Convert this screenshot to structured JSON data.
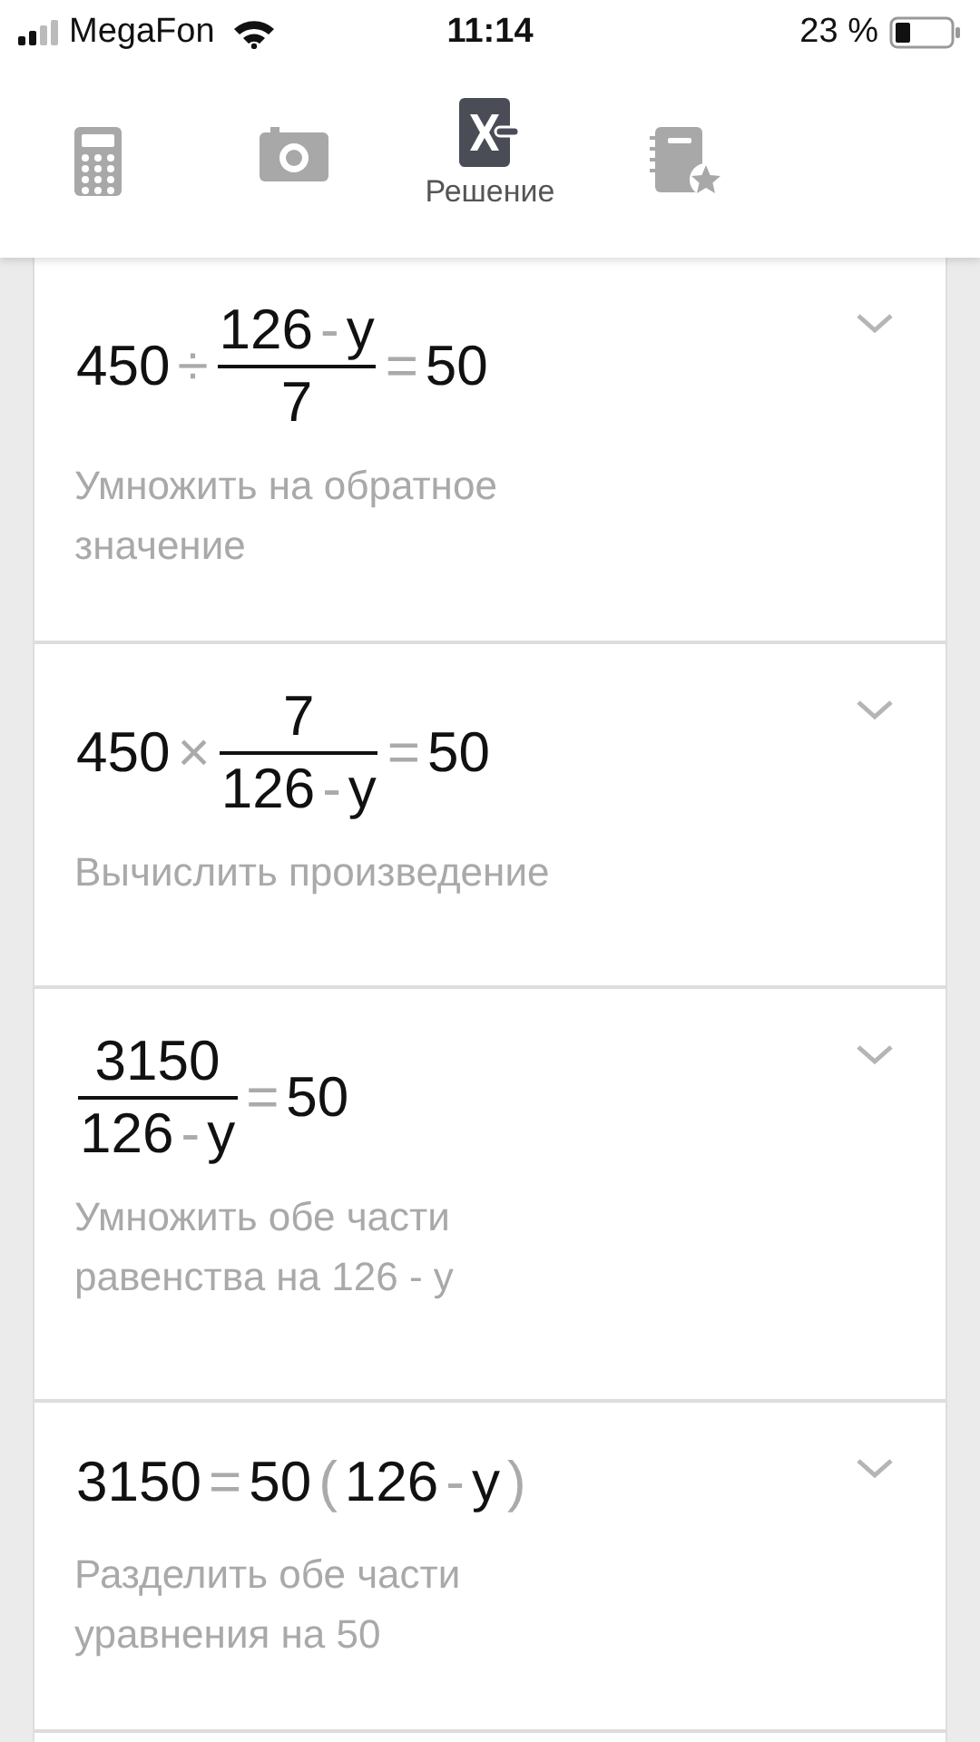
{
  "status_bar": {
    "carrier": "MegaFon",
    "time": "11:14",
    "battery": "23 %"
  },
  "tabs": [
    {
      "kind": "calculator",
      "selected": false
    },
    {
      "kind": "camera",
      "selected": false
    },
    {
      "kind": "solver",
      "label": "Решение",
      "selected": true
    },
    {
      "kind": "notebook",
      "selected": false
    }
  ],
  "steps": [
    {
      "expression": [
        {
          "kind": "num",
          "text": "450"
        },
        {
          "kind": "op",
          "text": "÷"
        },
        {
          "kind": "frac",
          "num": [
            {
              "kind": "num",
              "text": "126"
            },
            {
              "kind": "op",
              "text": "-"
            },
            {
              "kind": "num",
              "text": "y"
            }
          ],
          "den": [
            {
              "kind": "num",
              "text": "7"
            }
          ]
        },
        {
          "kind": "op",
          "text": "="
        },
        {
          "kind": "num",
          "text": "50"
        }
      ],
      "description": "Умножить на обратное значение"
    },
    {
      "expression": [
        {
          "kind": "num",
          "text": "450"
        },
        {
          "kind": "op",
          "text": "×"
        },
        {
          "kind": "frac",
          "num": [
            {
              "kind": "num",
              "text": "7"
            }
          ],
          "den": [
            {
              "kind": "num",
              "text": "126"
            },
            {
              "kind": "op",
              "text": "-"
            },
            {
              "kind": "num",
              "text": "y"
            }
          ]
        },
        {
          "kind": "op",
          "text": "="
        },
        {
          "kind": "num",
          "text": "50"
        }
      ],
      "description": "Вычислить произведение"
    },
    {
      "expression": [
        {
          "kind": "frac",
          "num": [
            {
              "kind": "num",
              "text": "3150"
            }
          ],
          "den": [
            {
              "kind": "num",
              "text": "126"
            },
            {
              "kind": "op",
              "text": "-"
            },
            {
              "kind": "num",
              "text": "y"
            }
          ]
        },
        {
          "kind": "op",
          "text": "="
        },
        {
          "kind": "num",
          "text": "50"
        }
      ],
      "description": "Умножить обе части равенства на 126 - y"
    },
    {
      "expression": [
        {
          "kind": "num",
          "text": "3150"
        },
        {
          "kind": "op",
          "text": "="
        },
        {
          "kind": "num",
          "text": "50"
        },
        {
          "kind": "op",
          "text": "("
        },
        {
          "kind": "num",
          "text": "126"
        },
        {
          "kind": "op",
          "text": "-"
        },
        {
          "kind": "num",
          "text": "y"
        },
        {
          "kind": "op",
          "text": ")"
        }
      ],
      "description": "Разделить обе части уравнения на 50"
    }
  ]
}
